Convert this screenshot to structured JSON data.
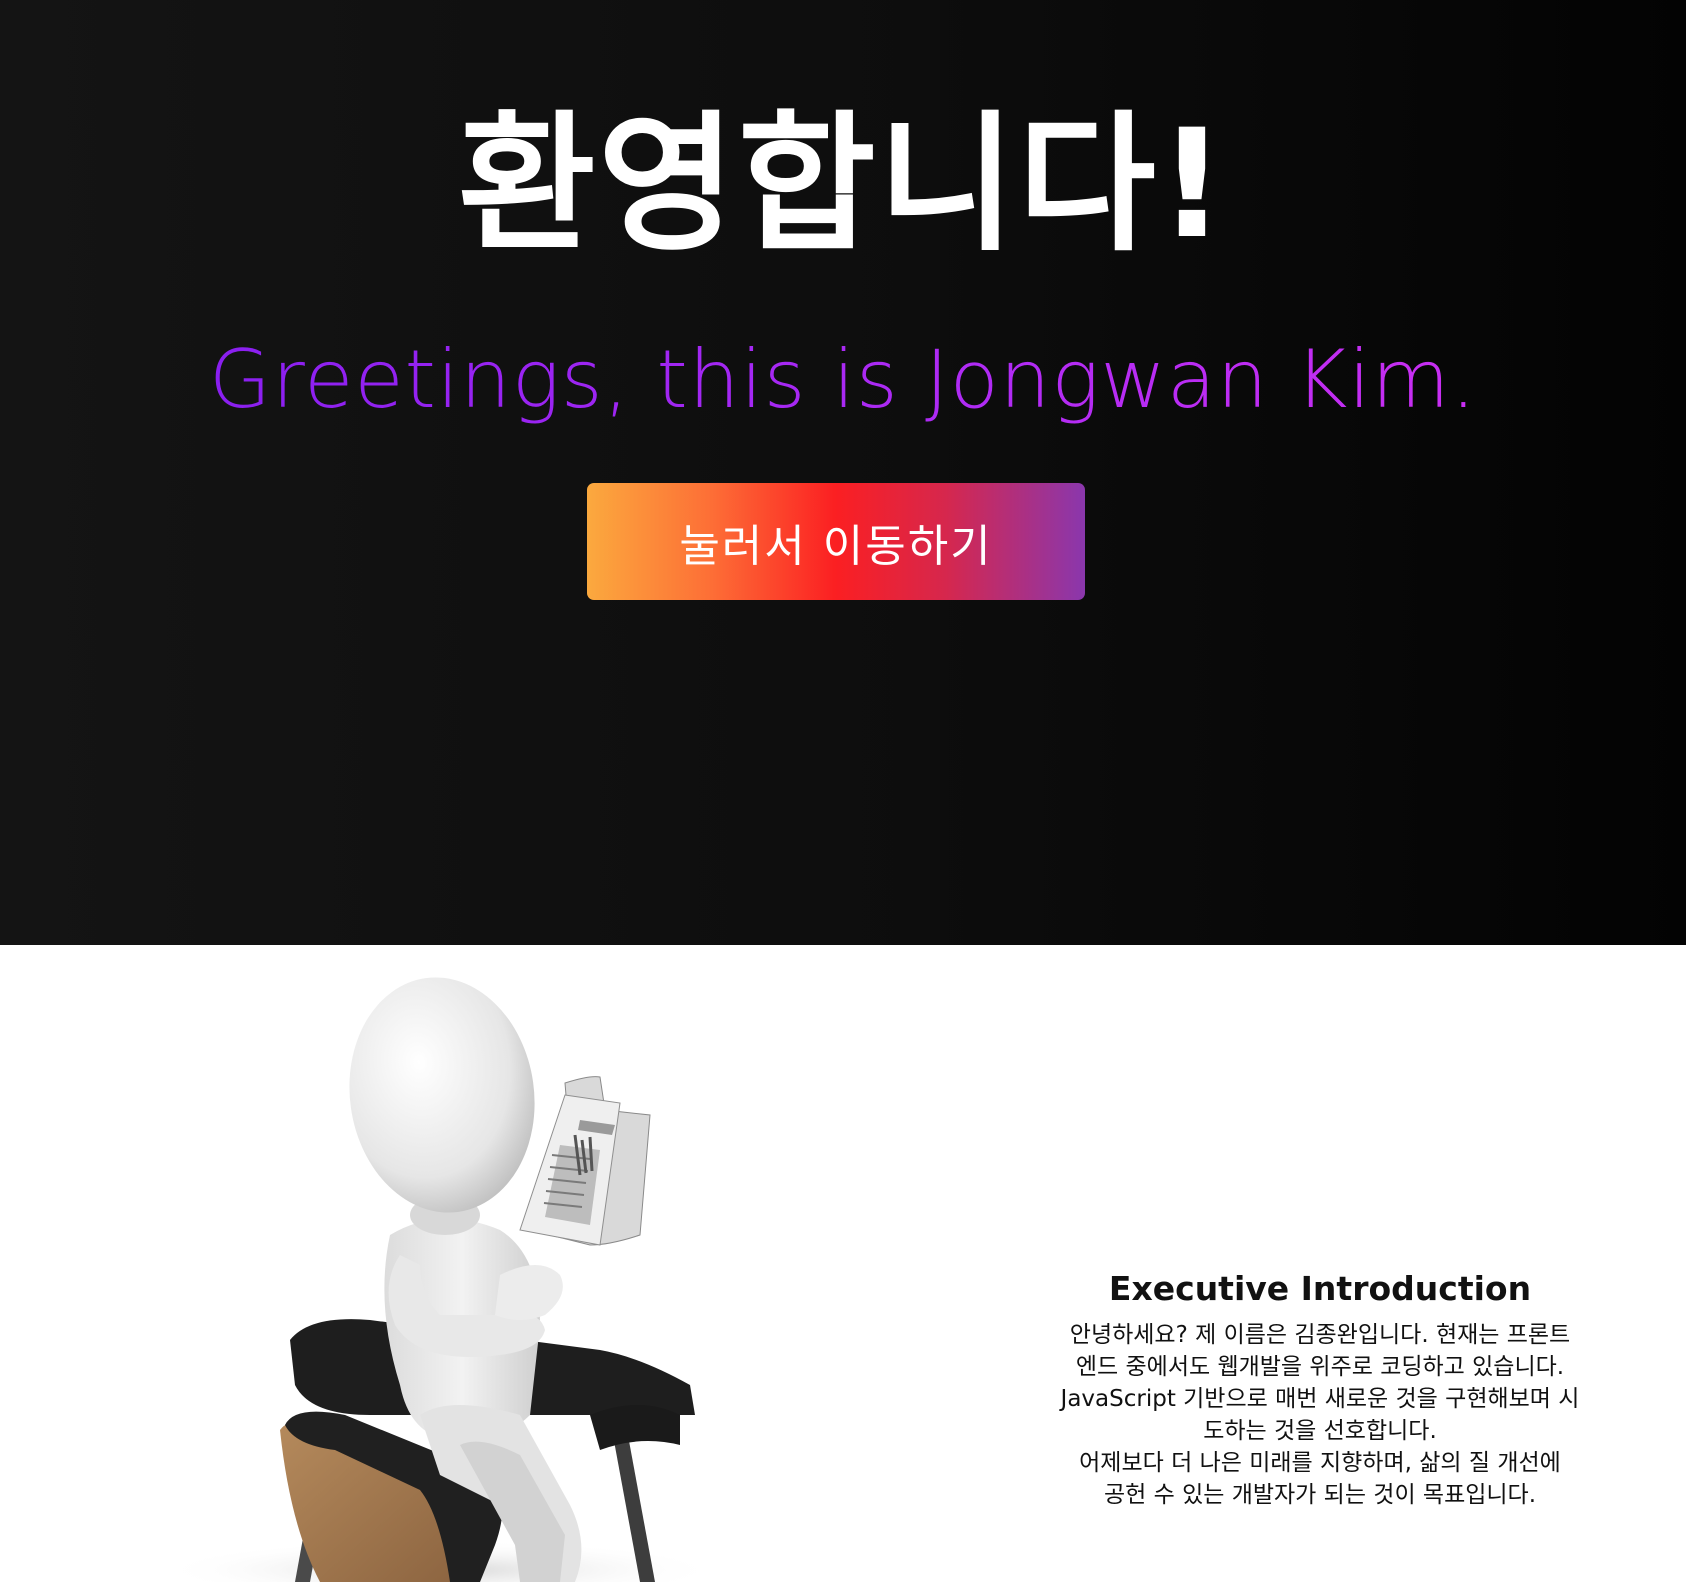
{
  "hero": {
    "title": "환영합니다!",
    "subtitle": "Greetings, this is Jongwan Kim.",
    "button_label": "눌러서 이동하기"
  },
  "intro": {
    "heading": "Executive Introduction",
    "body_lines": [
      "안녕하세요? 제 이름은 김종완입니다. 현재는 프론트",
      "엔드 중에서도 웹개발을 위주로 코딩하고 있습니다.",
      "JavaScript 기반으로 매번 새로운 것을 구현해보며 시",
      "도하는 것을 선호합니다.",
      "어제보다 더 나은 미래를 지향하며, 삶의 질 개선에",
      "공헌 수 있는 개발자가 되는 것이 목표입니다."
    ],
    "illustration_icon": "person-reading-newspaper-icon"
  },
  "colors": {
    "hero_background": "#0d0d0d",
    "subtitle_gradient_start": "#8a1ff0",
    "subtitle_gradient_end": "#c92ef2",
    "button_gradient": [
      "#fba93e",
      "#fb1f22",
      "#8a37ad"
    ]
  }
}
